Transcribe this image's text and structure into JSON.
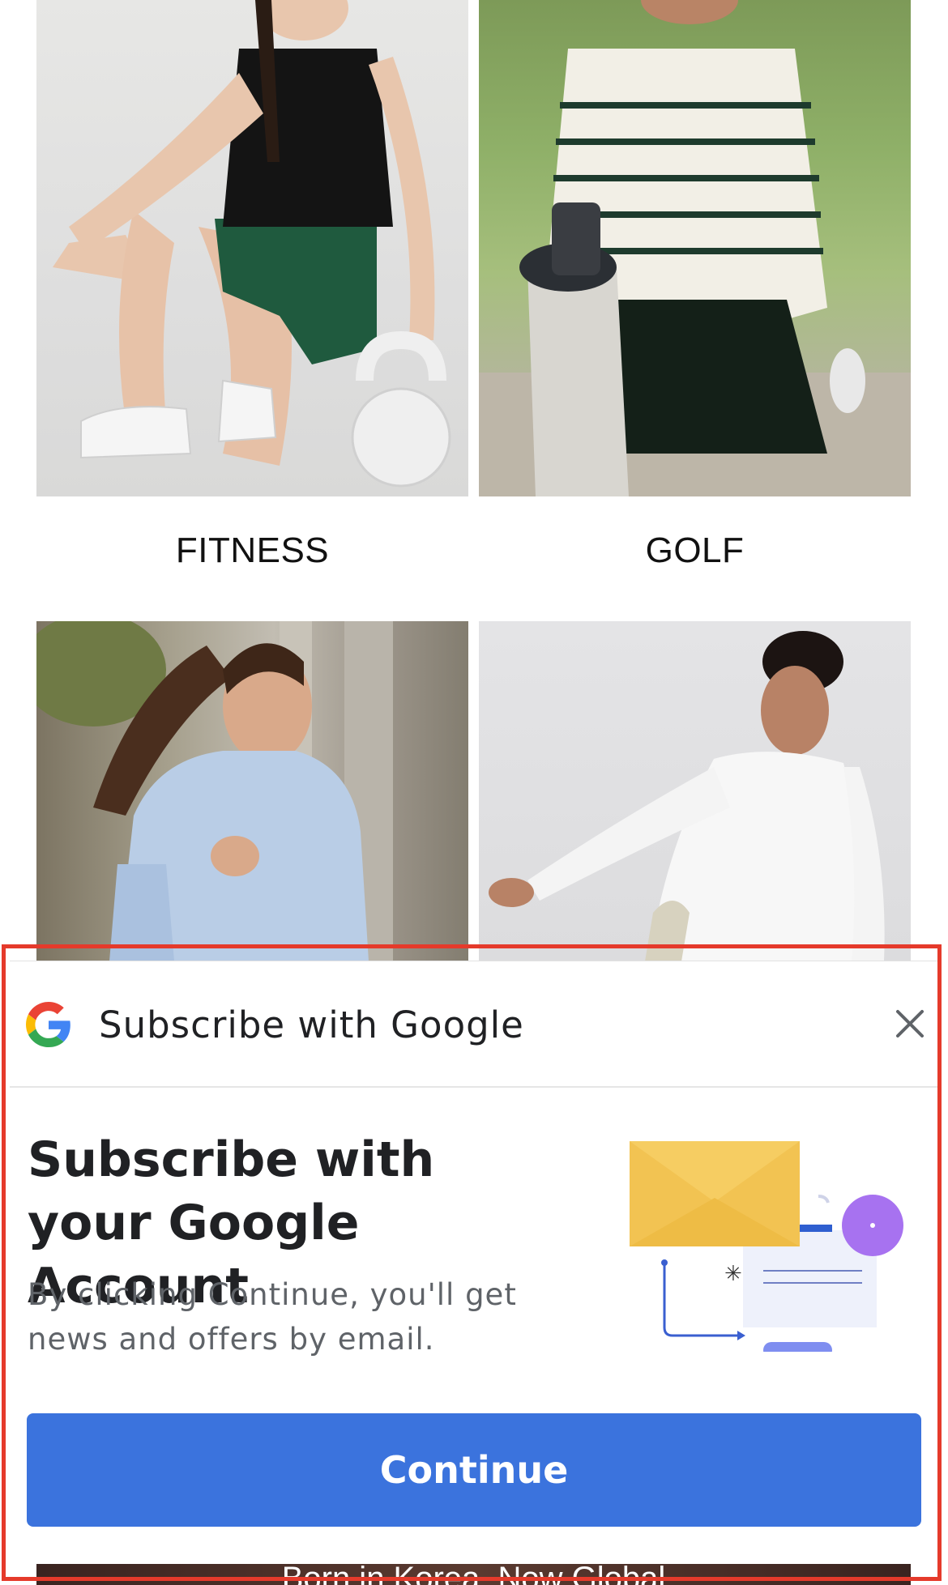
{
  "grid": {
    "tiles": [
      {
        "name": "fitness",
        "caption": "FITNESS"
      },
      {
        "name": "golf",
        "caption": "GOLF"
      },
      {
        "name": "running",
        "caption": ""
      },
      {
        "name": "yoga",
        "caption": ""
      }
    ]
  },
  "banner": {
    "text": "Born in Korea, Now Global"
  },
  "subscribe_sheet": {
    "header_title": "Subscribe with Google",
    "headline": "Subscribe with your Google Account",
    "description": "By clicking Continue, you'll get news and offers by email.",
    "continue_label": "Continue",
    "icons": {
      "logo": "google-g-icon",
      "close": "close-icon",
      "illustration": "email-subscription-illustration"
    }
  },
  "colors": {
    "button": "#3b73dd",
    "highlight_border": "#e53a2b",
    "google_blue": "#4285f4",
    "google_red": "#ea4335",
    "google_yellow": "#fbbc05",
    "google_green": "#34a853"
  }
}
